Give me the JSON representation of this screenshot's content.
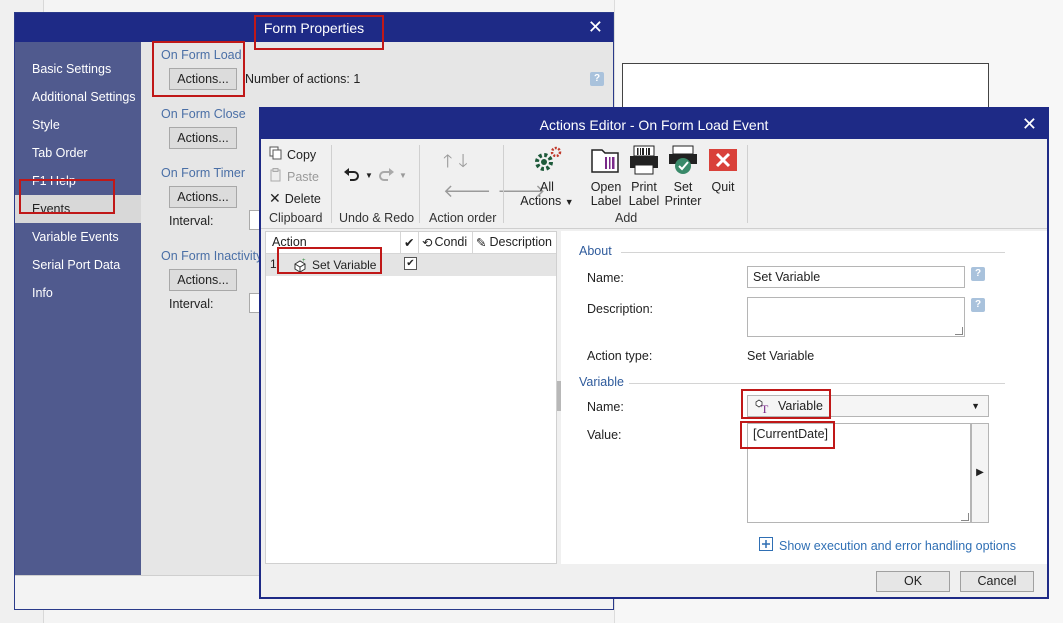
{
  "form_properties": {
    "title": "Form Properties",
    "sidebar": [
      {
        "label": "Basic Settings"
      },
      {
        "label": "Additional Settings"
      },
      {
        "label": "Style"
      },
      {
        "label": "Tab Order"
      },
      {
        "label": "F1 Help"
      },
      {
        "label": "Events",
        "active": true
      },
      {
        "label": "Variable Events"
      },
      {
        "label": "Serial Port Data"
      },
      {
        "label": "Info"
      }
    ],
    "events": {
      "on_form_load": "On Form Load",
      "on_form_close": "On Form Close",
      "on_form_timer": "On Form Timer",
      "on_form_inactivity": "On Form Inactivity",
      "actions_button": "Actions...",
      "number_of_actions": "Number of actions: 1",
      "interval_label": "Interval:"
    }
  },
  "actions_editor": {
    "title": "Actions Editor - On Form Load Event",
    "ribbon": {
      "clipboard": {
        "copy": "Copy",
        "paste": "Paste",
        "delete": "Delete",
        "group": "Clipboard"
      },
      "undo_redo": {
        "group": "Undo & Redo"
      },
      "action_order": {
        "group": "Action order"
      },
      "all_actions": {
        "line1": "All",
        "line2": "Actions"
      },
      "open_label": {
        "line1": "Open",
        "line2": "Label"
      },
      "print_label": {
        "line1": "Print",
        "line2": "Label"
      },
      "set_printer": {
        "line1": "Set",
        "line2": "Printer"
      },
      "quit": "Quit",
      "add_group": "Add"
    },
    "list": {
      "columns": {
        "action": "Action",
        "condition": "Condi",
        "description": "Description"
      },
      "rows": [
        {
          "index": "1",
          "name": "Set Variable",
          "checked": true
        }
      ]
    },
    "about": {
      "section": "About",
      "name_label": "Name:",
      "name_value": "Set Variable",
      "description_label": "Description:",
      "description_value": "",
      "action_type_label": "Action type:",
      "action_type_value": "Set Variable"
    },
    "variable": {
      "section": "Variable",
      "name_label": "Name:",
      "name_value": "Variable",
      "value_label": "Value:",
      "value_value": "[CurrentDate]"
    },
    "show_options_link": "Show execution and error handling options",
    "ok": "OK",
    "cancel": "Cancel"
  },
  "colors": {
    "title_bar": "#1e2a86",
    "sidebar": "#505a8e",
    "highlight": "#c01818",
    "section_title": "#2f5b9c",
    "link": "#2f6fb4"
  }
}
